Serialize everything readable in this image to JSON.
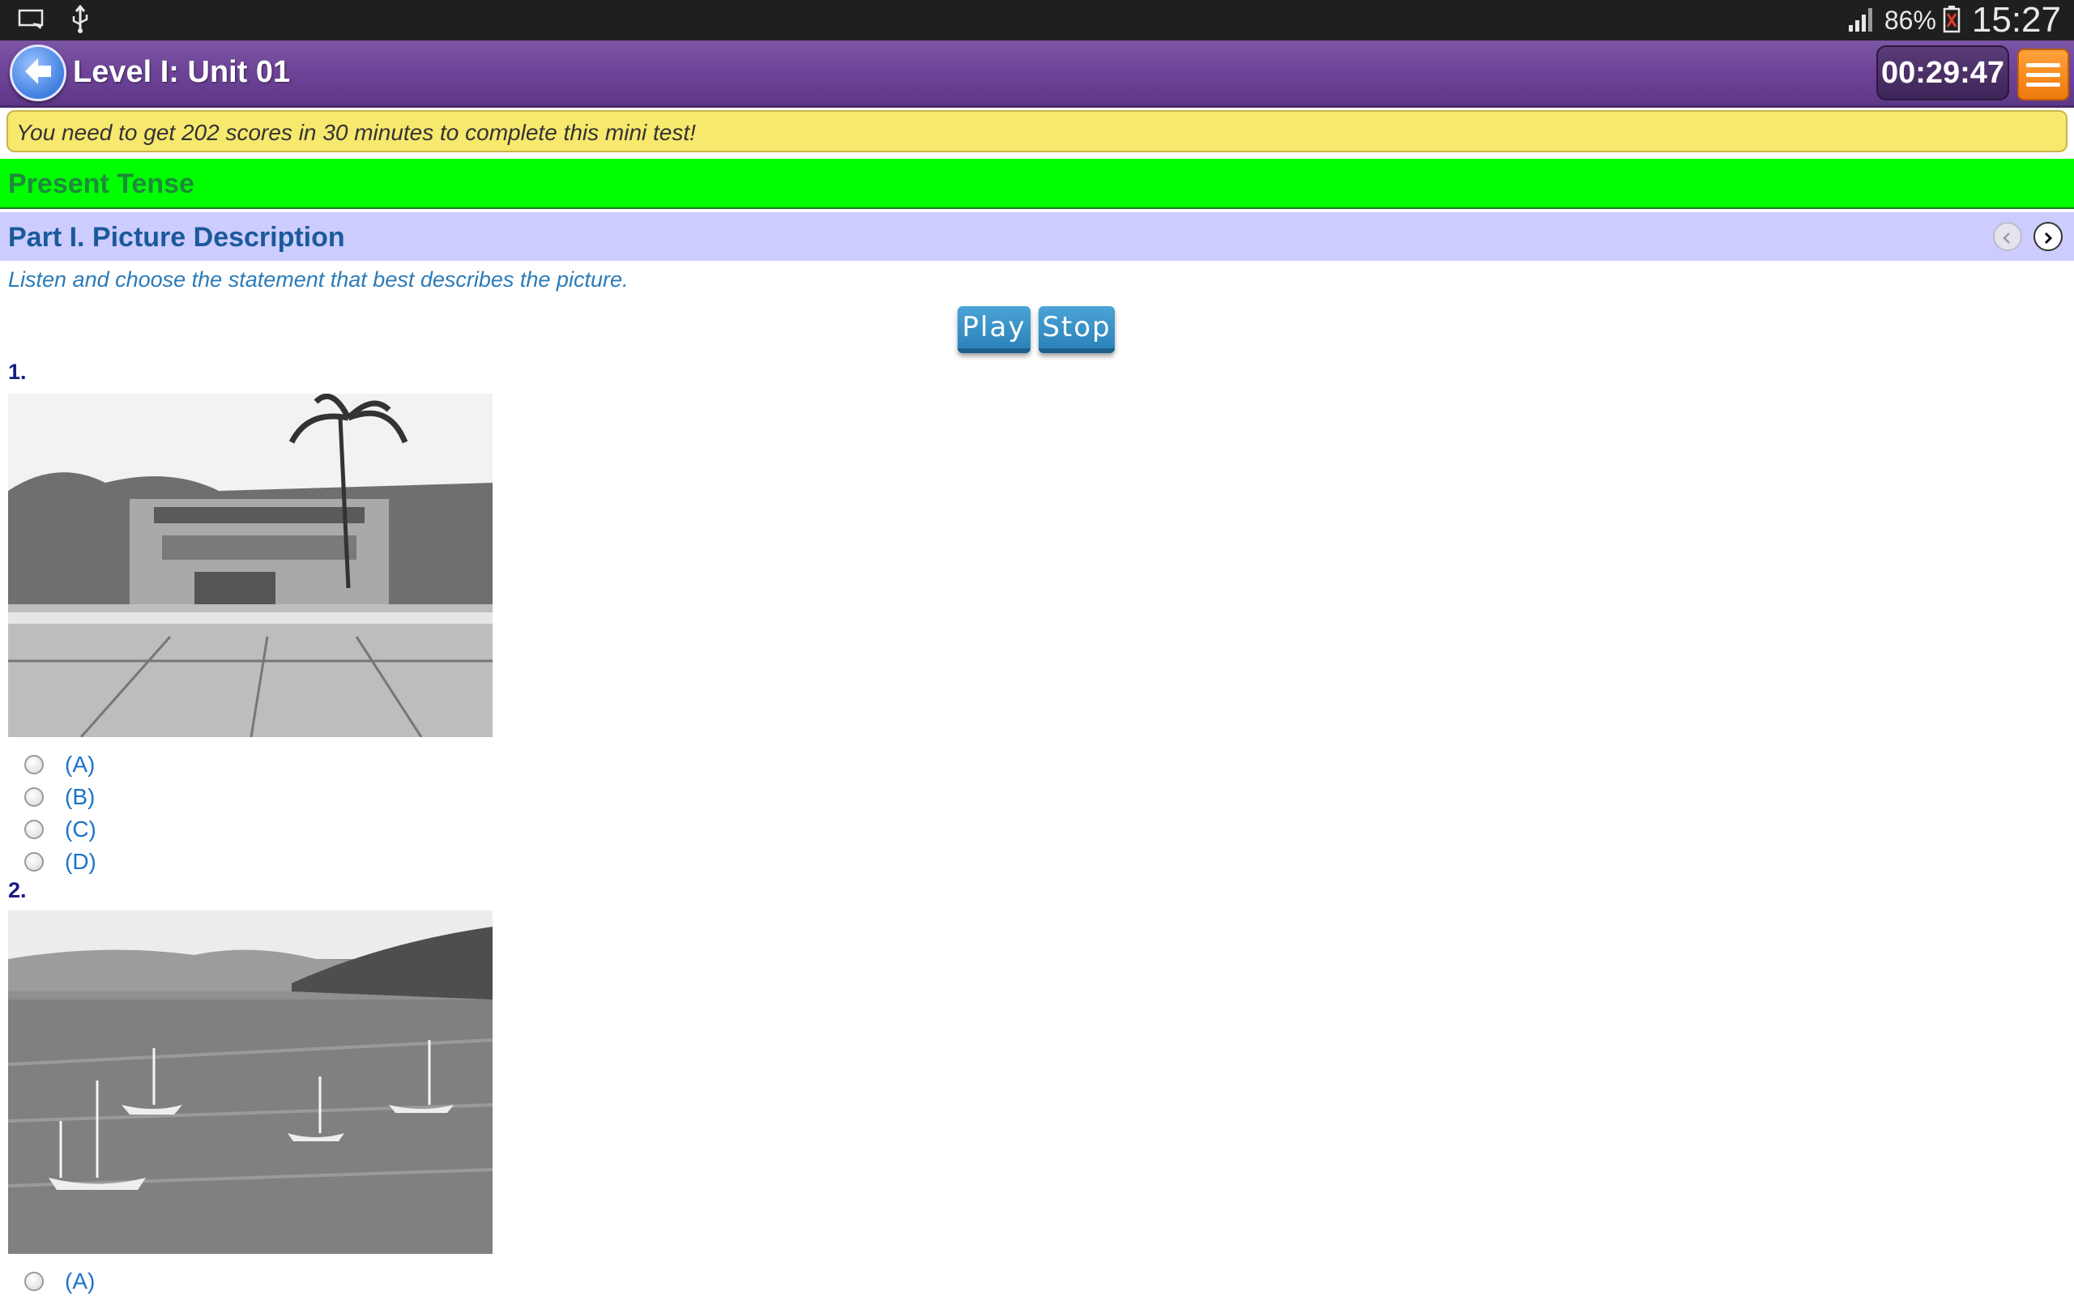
{
  "status_bar": {
    "battery": "86%",
    "time": "15:27",
    "icons": [
      "screen-cast-icon",
      "usb-icon",
      "signal-icon",
      "battery-icon"
    ]
  },
  "header": {
    "title": "Level I: Unit 01",
    "timer": "00:29:47",
    "colors": {
      "bar": "#6d4397",
      "menu": "#f07a0c"
    }
  },
  "notice": {
    "text": "You need to get 202 scores in 30 minutes to complete this mini test!"
  },
  "topic": {
    "text": "Present Tense"
  },
  "part": {
    "title": "Part I. Picture Description"
  },
  "instruction": {
    "text": "Listen and choose the statement that best describes the picture."
  },
  "audio": {
    "play_label": "Play",
    "stop_label": "Stop"
  },
  "questions": [
    {
      "number": "1.",
      "options": [
        "(A)",
        "(B)",
        "(C)",
        "(D)"
      ]
    },
    {
      "number": "2.",
      "options": [
        "(A)"
      ]
    }
  ]
}
